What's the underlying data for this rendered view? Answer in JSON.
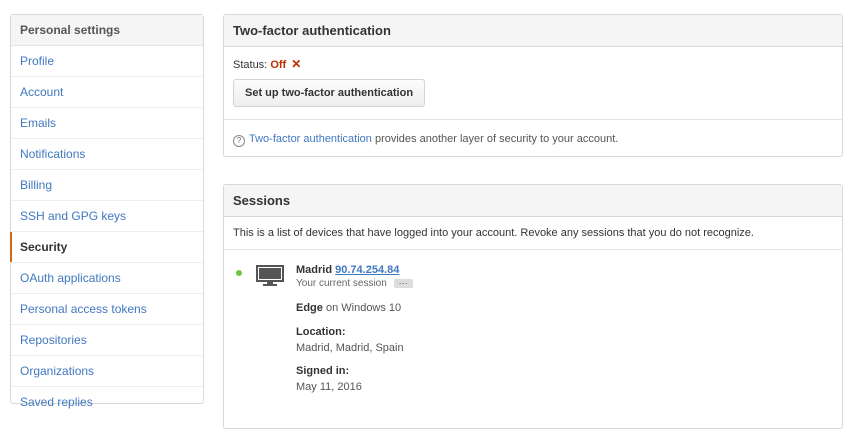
{
  "sidebar": {
    "heading": "Personal settings",
    "items": [
      {
        "label": "Profile"
      },
      {
        "label": "Account"
      },
      {
        "label": "Emails"
      },
      {
        "label": "Notifications"
      },
      {
        "label": "Billing"
      },
      {
        "label": "SSH and GPG keys"
      },
      {
        "label": "Security"
      },
      {
        "label": "OAuth applications"
      },
      {
        "label": "Personal access tokens"
      },
      {
        "label": "Repositories"
      },
      {
        "label": "Organizations"
      },
      {
        "label": "Saved replies"
      }
    ]
  },
  "two_factor": {
    "title": "Two-factor authentication",
    "status_label": "Status:",
    "status_value": "Off",
    "status_icon": "✕",
    "setup_button": "Set up two-factor authentication",
    "hint_link": "Two-factor authentication",
    "hint_text": " provides another layer of security to your account."
  },
  "sessions": {
    "title": "Sessions",
    "description": "This is a list of devices that have logged into your account. Revoke any sessions that you do not recognize.",
    "current": {
      "city": "Madrid",
      "ip": "90.74.254.84",
      "current_label": "Your current session",
      "ellipsis": "···",
      "browser": "Edge",
      "os_text": " on Windows 10",
      "location_label": "Location:",
      "location_value": "Madrid, Madrid, Spain",
      "signed_in_label": "Signed in:",
      "signed_in_value": "May 11, 2016"
    }
  },
  "colors": {
    "link": "#4078c0",
    "active_accent": "#d26911",
    "status_off": "#bd2c00",
    "online_dot": "#6cc644"
  }
}
